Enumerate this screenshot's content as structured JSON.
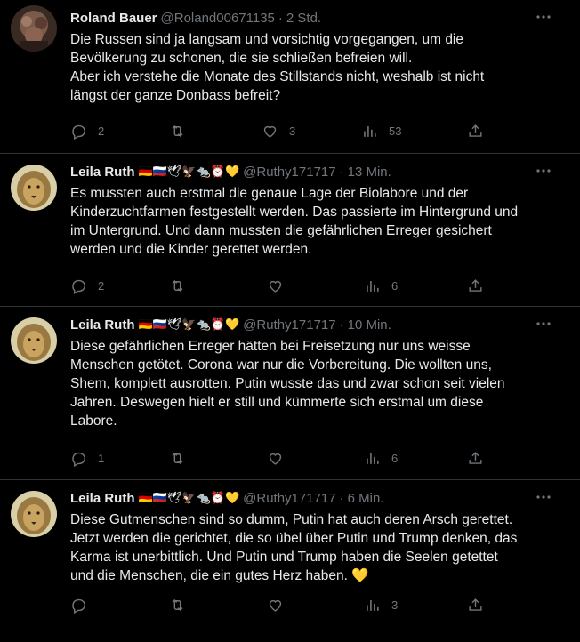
{
  "tweets": [
    {
      "name": "Roland Bauer",
      "emojis": "",
      "handle": "@Roland00671135",
      "sep": "·",
      "time": "2 Std.",
      "text": "Die Russen sind ja langsam und vorsichtig vorgegangen, um die\nBevölkerung zu schonen, die sie schließen befreien will.\nAber ich verstehe die Monate des Stillstands nicht, weshalb ist nicht\nlängst der ganze Donbass befreit?",
      "replies": "2",
      "retweets": "",
      "likes": "3",
      "views": "53"
    },
    {
      "name": "Leila Ruth",
      "emojis": "🇩🇪🇷🇺🕊🦅🐀⏰💛",
      "handle": "@Ruthy171717",
      "sep": "·",
      "time": "13 Min.",
      "text": "Es mussten auch erstmal die genaue Lage der Biolabore und der\nKinderzuchtfarmen festgestellt werden. Das passierte im Hintergrund und\nim Untergrund. Und dann mussten die gefährlichen Erreger gesichert\nwerden und die Kinder gerettet werden.",
      "replies": "2",
      "retweets": "",
      "likes": "",
      "views": "6"
    },
    {
      "name": "Leila Ruth",
      "emojis": "🇩🇪🇷🇺🕊🦅🐀⏰💛",
      "handle": "@Ruthy171717",
      "sep": "·",
      "time": "10 Min.",
      "text": "Diese gefährlichen Erreger hätten bei Freisetzung nur uns weisse\nMenschen getötet. Corona war nur die Vorbereitung. Die wollten uns,\nShem, komplett ausrotten. Putin wusste das und zwar schon seit vielen\nJahren. Deswegen hielt er still und kümmerte sich erstmal um diese\nLabore.",
      "replies": "1",
      "retweets": "",
      "likes": "",
      "views": "6"
    },
    {
      "name": "Leila Ruth",
      "emojis": "🇩🇪🇷🇺🕊🦅🐀⏰💛",
      "handle": "@Ruthy171717",
      "sep": "·",
      "time": "6 Min.",
      "text": "Diese Gutmenschen sind so dumm, Putin hat auch deren Arsch gerettet.\nJetzt werden die gerichtet, die so übel über Putin und Trump denken, das\nKarma ist unerbittlich. Und Putin und Trump haben die Seelen getettet\nund die Menschen, die ein gutes Herz haben. 💛",
      "replies": "",
      "retweets": "",
      "likes": "",
      "views": "3"
    }
  ],
  "colors": {
    "background": "#000000",
    "text": "#e7e9ea",
    "secondary": "#71767b",
    "divider": "#2f3336"
  },
  "icons": [
    "more-icon",
    "reply-icon",
    "retweet-icon",
    "like-icon",
    "views-icon",
    "share-icon"
  ]
}
